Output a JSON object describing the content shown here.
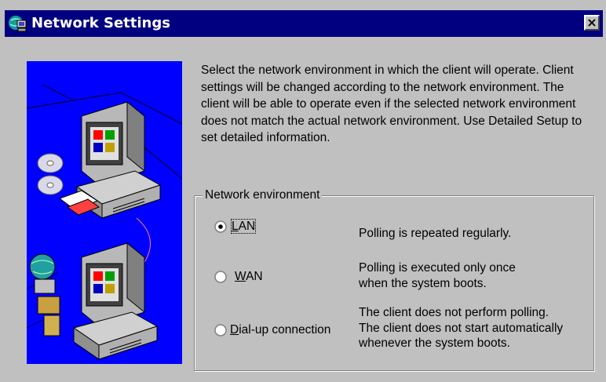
{
  "window": {
    "title": "Network Settings",
    "close_glyph": "×",
    "title_icon": "network-app-icon",
    "colors": {
      "titlebar": "#000080",
      "face": "#c0c0c0",
      "illustration_bg": "#0000ff"
    }
  },
  "description": "Select the network environment in which the client will operate. Client settings will be changed according to the network environment. The client will be able to operate even if the selected network environment does not match the actual network environment. Use Detailed Setup to set detailed information.",
  "network_environment": {
    "legend": "Network environment",
    "options": [
      {
        "label_mnemonic": "L",
        "label_rest": "AN",
        "selected": true,
        "description_lines": [
          "Polling is repeated regularly."
        ]
      },
      {
        "label_mnemonic": "W",
        "label_rest": "AN",
        "selected": false,
        "description_lines": [
          "Polling is executed only once",
          "when the system boots."
        ]
      },
      {
        "label_mnemonic": "D",
        "label_rest": "ial-up connection",
        "selected": false,
        "description_lines": [
          "The client does not perform polling.",
          "The client does not start automatically",
          "whenever the system boots."
        ]
      }
    ]
  }
}
